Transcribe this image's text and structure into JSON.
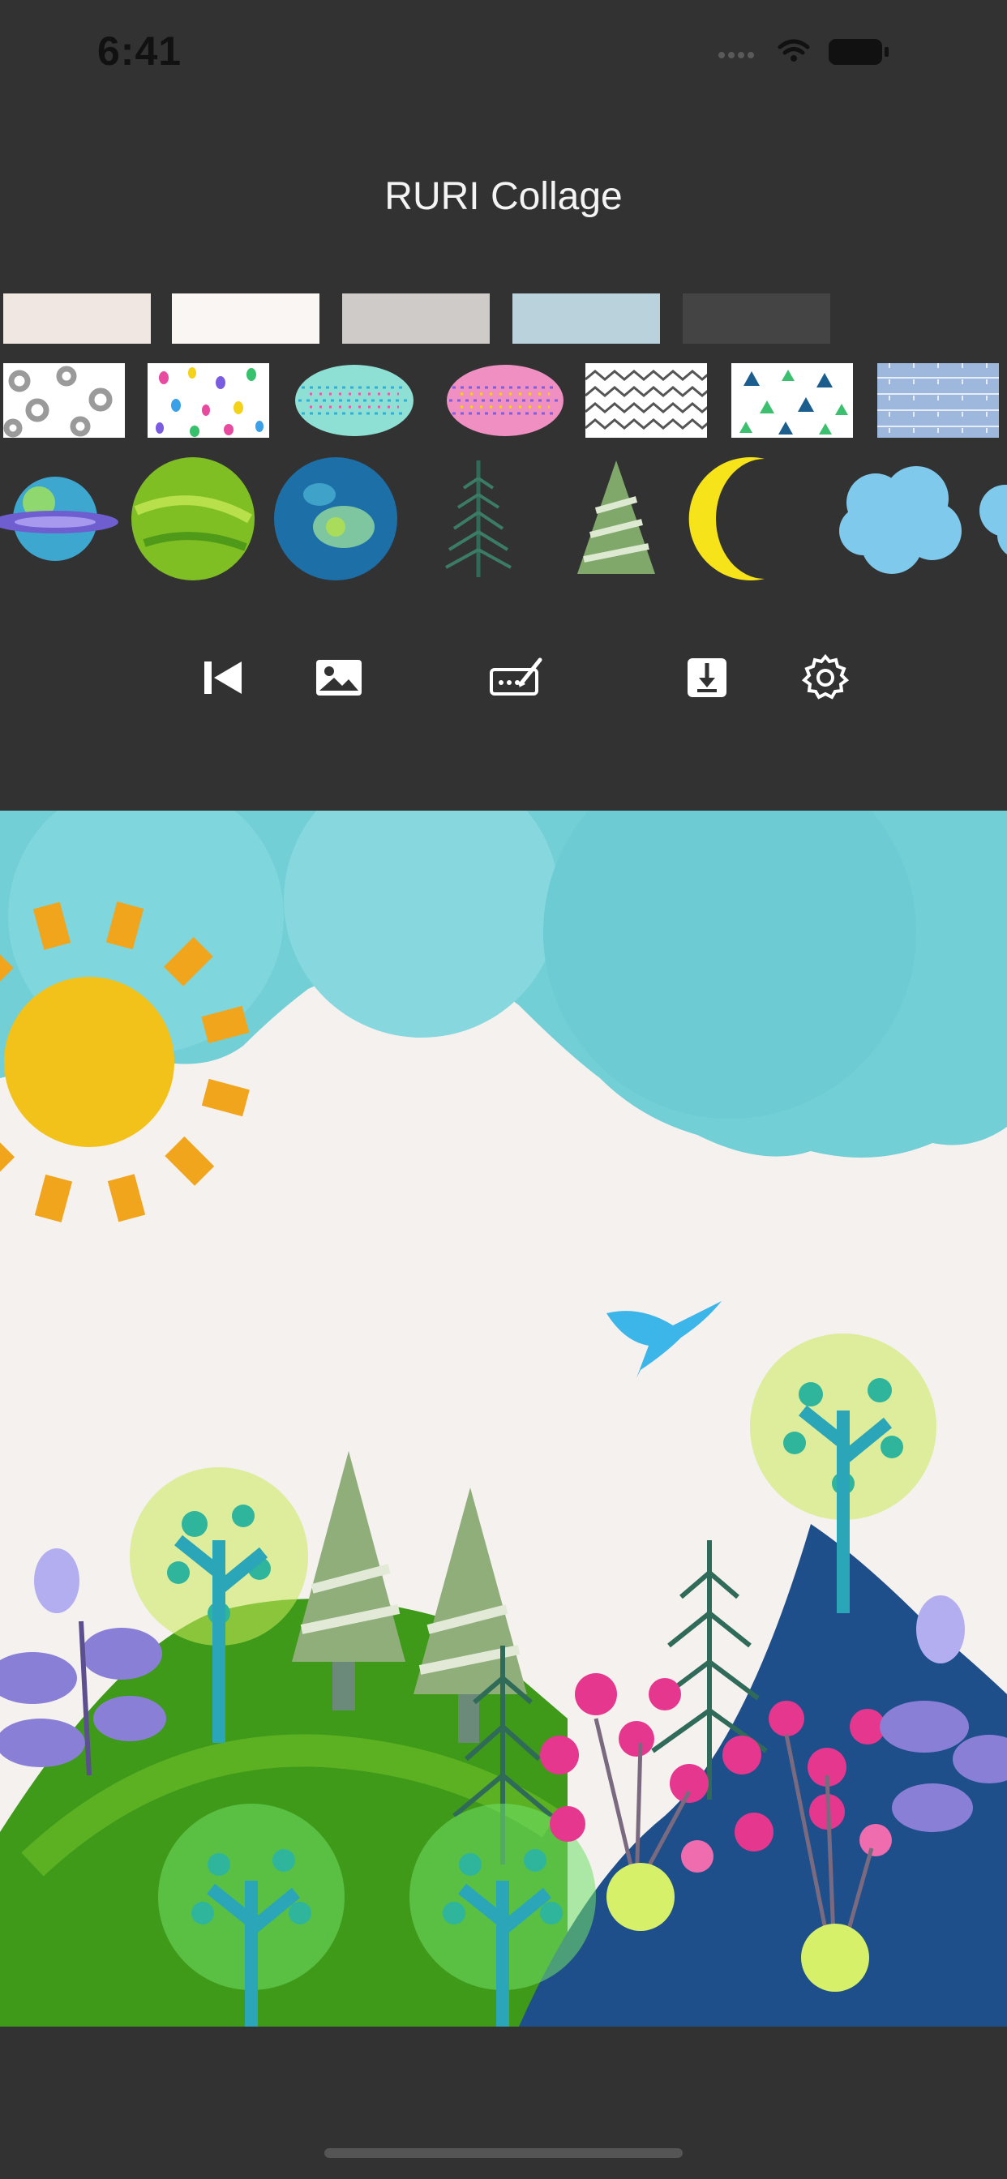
{
  "status": {
    "time": "6:41"
  },
  "header": {
    "title": "RURI Collage"
  },
  "palette": {
    "papers": [
      {
        "name": "paper-pink",
        "color": "#f0e6e2"
      },
      {
        "name": "paper-white",
        "color": "#faf6f4"
      },
      {
        "name": "paper-gray",
        "color": "#cfcbc9"
      },
      {
        "name": "paper-blue",
        "color": "#b9d2dc"
      },
      {
        "name": "paper-dark",
        "color": "#444444"
      }
    ],
    "patterns": [
      {
        "name": "pattern-gray-circles",
        "color": "#ffffff"
      },
      {
        "name": "pattern-color-dots",
        "color": "#ffffff"
      },
      {
        "name": "pattern-aqua-blob",
        "color": "#7fd7cf"
      },
      {
        "name": "pattern-pink-blob",
        "color": "#e58bc0"
      },
      {
        "name": "pattern-zigzag",
        "color": "#ffffff"
      },
      {
        "name": "pattern-triangles",
        "color": "#ffffff"
      },
      {
        "name": "pattern-blue-stripes",
        "color": "#9db7dd"
      }
    ],
    "stickers": [
      {
        "name": "planet-sticker"
      },
      {
        "name": "green-circle-sticker"
      },
      {
        "name": "earth-circle-sticker"
      },
      {
        "name": "pine-tree-sticker"
      },
      {
        "name": "green-tree-sticker"
      },
      {
        "name": "moon-sticker"
      },
      {
        "name": "blue-cloud-sticker"
      },
      {
        "name": "blue-cloud-partial-sticker"
      }
    ]
  },
  "toolbar": {
    "buttons": [
      {
        "name": "skip-back-icon"
      },
      {
        "name": "image-icon"
      },
      {
        "name": "signature-icon"
      },
      {
        "name": "download-icon"
      },
      {
        "name": "gear-icon"
      }
    ]
  },
  "colors": {
    "background": "#323232",
    "sky": "#72cfd6",
    "sun": "#f3c21a",
    "bird": "#3cb6e8",
    "hill_green": "#3e9a18",
    "mountain_blue": "#1f4f8a",
    "flower_pink": "#e6378f"
  }
}
